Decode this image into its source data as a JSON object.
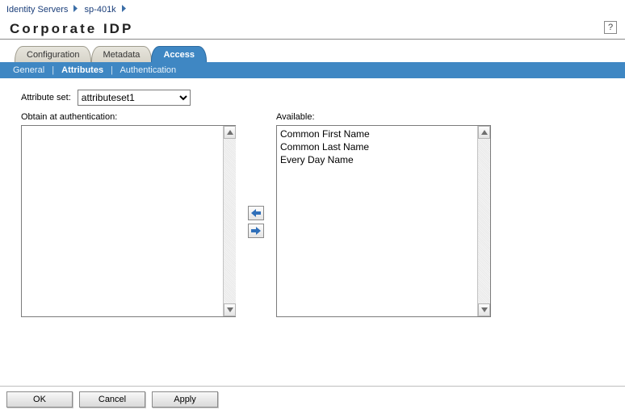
{
  "breadcrumb": {
    "items": [
      {
        "label": "Identity Servers"
      },
      {
        "label": "sp-401k"
      }
    ]
  },
  "page_title": "Corporate IDP",
  "help_icon_label": "?",
  "tabs": {
    "configuration": "Configuration",
    "metadata": "Metadata",
    "access": "Access"
  },
  "subtabs": {
    "general": "General",
    "attributes": "Attributes",
    "authentication": "Authentication"
  },
  "form": {
    "attribute_set_label": "Attribute set:",
    "attribute_set_value": "attributeset1",
    "obtain_label": "Obtain at authentication:",
    "available_label": "Available:",
    "obtain_items": [],
    "available_items": [
      "Common First Name",
      "Common Last Name",
      "Every Day Name"
    ]
  },
  "buttons": {
    "ok": "OK",
    "cancel": "Cancel",
    "apply": "Apply"
  }
}
